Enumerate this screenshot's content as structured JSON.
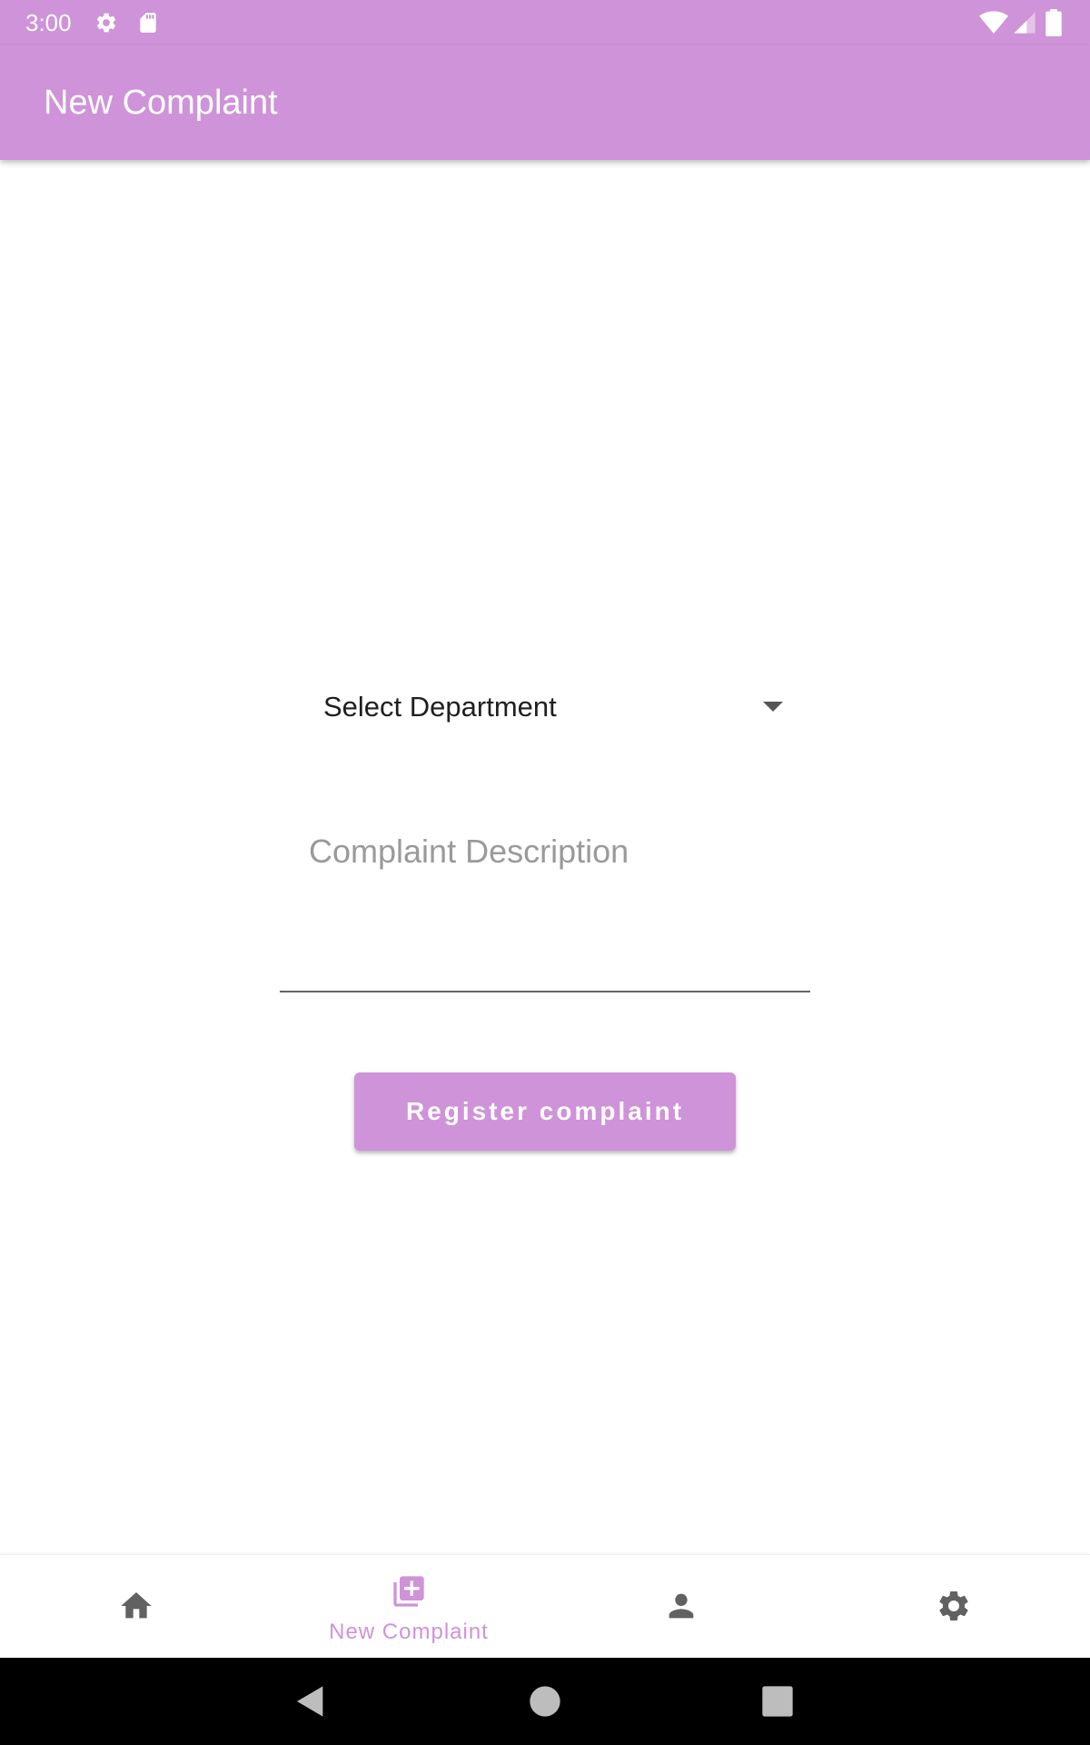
{
  "status_bar": {
    "time": "3:00",
    "icons": [
      "settings-icon",
      "sd-card-icon",
      "wifi-icon",
      "signal-icon",
      "battery-icon"
    ]
  },
  "app_bar": {
    "title": "New Complaint"
  },
  "form": {
    "department_dropdown": {
      "selected": "Select Department"
    },
    "description": {
      "placeholder": "Complaint Description",
      "value": ""
    },
    "register_button": {
      "label": "Register complaint"
    }
  },
  "bottom_nav": {
    "items": [
      {
        "icon": "home-icon",
        "label": "",
        "active": false
      },
      {
        "icon": "add-to-photos-icon",
        "label": "New Complaint",
        "active": true
      },
      {
        "icon": "person-icon",
        "label": "",
        "active": false
      },
      {
        "icon": "gear-icon",
        "label": "",
        "active": false
      }
    ]
  },
  "system_nav": {
    "buttons": [
      "back-icon",
      "home-circle-icon",
      "recents-icon"
    ]
  },
  "colors": {
    "accent": "#ce93d8",
    "icon_inactive": "#616161",
    "system_nav_bg": "#000000"
  }
}
